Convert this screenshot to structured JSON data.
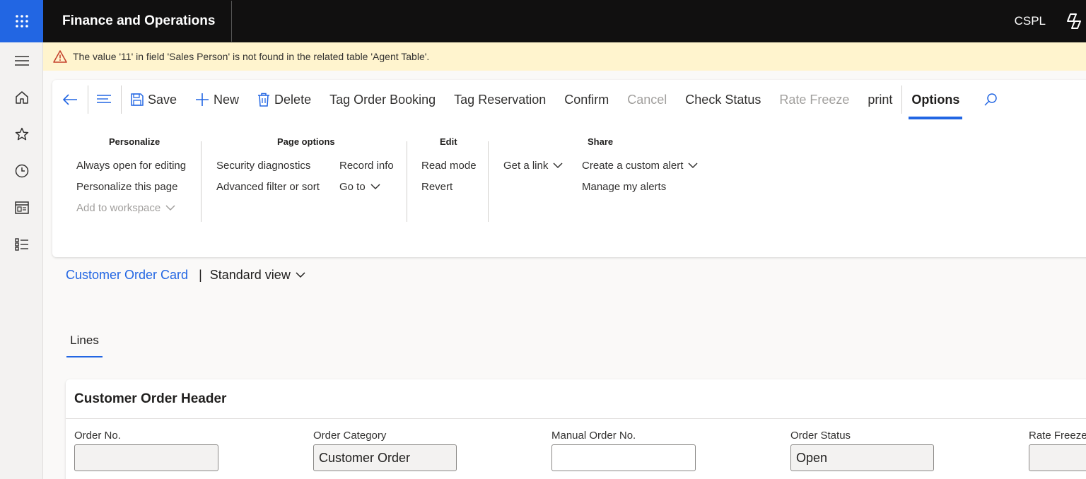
{
  "app": {
    "title": "Finance and Operations",
    "company": "CSPL"
  },
  "colors": {
    "accent": "#2266e3",
    "topbar": "#111010",
    "banner": "#fff4ce",
    "warning_icon": "#c5422c"
  },
  "rail": {
    "items": [
      {
        "icon": "hamburger-icon"
      },
      {
        "icon": "home-icon"
      },
      {
        "icon": "star-icon"
      },
      {
        "icon": "clock-icon"
      },
      {
        "icon": "workspace-icon"
      },
      {
        "icon": "list-icon"
      }
    ]
  },
  "banner": {
    "icon": "warning-icon",
    "message": "The value '11' in field 'Sales Person' is not found in the related table 'Agent Table'."
  },
  "toolbar": {
    "save": "Save",
    "new": "New",
    "delete": "Delete",
    "tag_order_booking": "Tag Order Booking",
    "tag_reservation": "Tag Reservation",
    "confirm": "Confirm",
    "cancel": "Cancel",
    "check_status": "Check Status",
    "rate_freeze": "Rate Freeze",
    "print": "print",
    "options_tab": "Options"
  },
  "options": {
    "personalize": {
      "title": "Personalize",
      "always_open": "Always open for editing",
      "personalize_page": "Personalize this page",
      "add_to_workspace": "Add to workspace"
    },
    "page_options": {
      "title": "Page options",
      "security_diagnostics": "Security diagnostics",
      "advanced_filter": "Advanced filter or sort",
      "record_info": "Record info",
      "go_to": "Go to"
    },
    "edit": {
      "title": "Edit",
      "read_mode": "Read mode",
      "revert": "Revert"
    },
    "share": {
      "title": "Share",
      "get_link": "Get a link",
      "create_alert": "Create a custom alert",
      "manage_alerts": "Manage my alerts"
    }
  },
  "breadcrumb": {
    "page": "Customer Order Card",
    "separator": "|",
    "view": "Standard view"
  },
  "tabs": {
    "lines": "Lines"
  },
  "header_card": {
    "title": "Customer Order Header",
    "fields": [
      {
        "label": "Order No.",
        "value": ""
      },
      {
        "label": "Order Category",
        "value": "Customer Order"
      },
      {
        "label": "Manual Order No.",
        "value": ""
      },
      {
        "label": "Order Status",
        "value": "Open"
      },
      {
        "label": "Rate Freeze",
        "value": ""
      }
    ]
  }
}
